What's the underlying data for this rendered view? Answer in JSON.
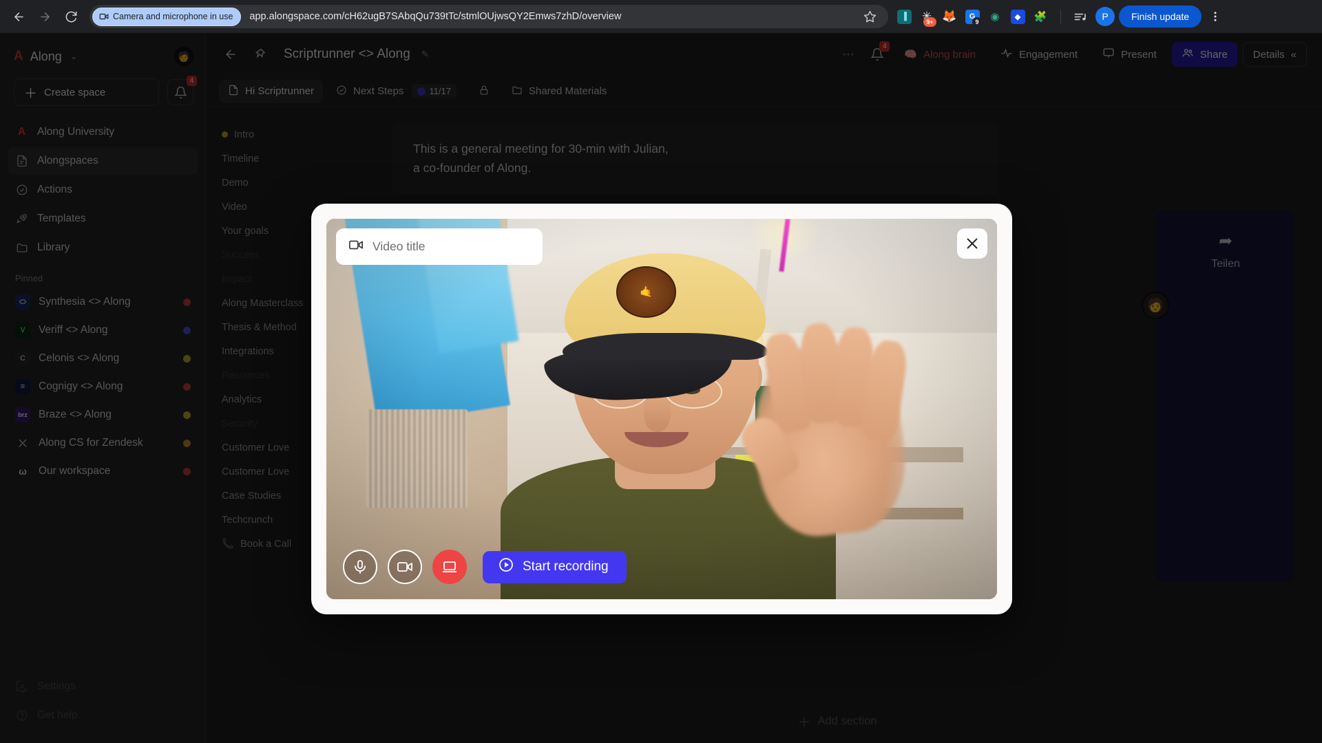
{
  "browser": {
    "back_icon": "arrow-left-icon",
    "forward_icon": "arrow-right-icon",
    "reload_icon": "reload-icon",
    "camera_chip": "Camera and microphone in use",
    "url": "app.alongspace.com/cH62ugB7SAbqQu739tTc/stmlOUjwsQY2Emws7zhD/overview",
    "star_icon": "bookmark-star-icon",
    "extensions": [
      {
        "name": "height-extension-icon",
        "glyph": "▐",
        "bg": "#0f6e73",
        "fg": "#7fe3e8",
        "badge": ""
      },
      {
        "name": "notifications-extension-icon",
        "glyph": "✻",
        "bg": "#f25c3c",
        "fg": "#ffffff",
        "badge": "9+"
      },
      {
        "name": "metamask-extension-icon",
        "glyph": "🦊",
        "bg": "transparent",
        "fg": "#e8883a",
        "badge": ""
      },
      {
        "name": "grammarly-extension-icon",
        "glyph": "G",
        "bg": "#1a73e8",
        "fg": "#ffffff",
        "badge": "9"
      },
      {
        "name": "eye-extension-icon",
        "glyph": "◉",
        "bg": "transparent",
        "fg": "#2ea88a",
        "badge": ""
      },
      {
        "name": "blue-extension-icon",
        "glyph": "◆",
        "bg": "#1b4ae0",
        "fg": "#ffffff",
        "badge": ""
      },
      {
        "name": "puzzle-extensions-icon",
        "glyph": "🧩",
        "bg": "transparent",
        "fg": "#bdc1c6",
        "badge": ""
      }
    ],
    "reading_list_icon": "reading-list-icon",
    "profile_initial": "P",
    "finish_update_label": "Finish update",
    "menu_icon": "kebab-menu-icon"
  },
  "sidebar": {
    "workspace": {
      "name": "Along",
      "caret": "⌄",
      "avatar_initial": ""
    },
    "create_space_label": "Create space",
    "notifications_badge": "4",
    "nav": [
      {
        "label": "Along University",
        "icon": "along-logo-icon",
        "active": false
      },
      {
        "label": "Alongspaces",
        "icon": "document-icon",
        "active": true
      },
      {
        "label": "Actions",
        "icon": "check-circle-icon",
        "active": false
      },
      {
        "label": "Templates",
        "icon": "rocket-icon",
        "active": false
      },
      {
        "label": "Library",
        "icon": "folder-icon",
        "active": false
      }
    ],
    "pinned_label": "Pinned",
    "pinned": [
      {
        "label": "Synthesia <> Along",
        "logo": "⬭",
        "logo_bg": "#1b2a63",
        "dot": "#c04040"
      },
      {
        "label": "Veriff <> Along",
        "logo": "V",
        "logo_bg": "#0c2a16",
        "dot": "#4b4fd0"
      },
      {
        "label": "Celonis <> Along",
        "logo": "C",
        "logo_bg": "#2a2a2a",
        "dot": "#b8ad33"
      },
      {
        "label": "Cognigy <> Along",
        "logo": "≡",
        "logo_bg": "#131a45",
        "dot": "#c04040"
      },
      {
        "label": "Braze <> Along",
        "logo": "b",
        "logo_bg": "#3a1a6e",
        "dot": "#b8ad33"
      },
      {
        "label": "Along CS for Zendesk",
        "logo": "✕",
        "logo_bg": "#2a2a2a",
        "dot": "#c08a33"
      },
      {
        "label": "Our workspace",
        "logo": "ω",
        "logo_bg": "#2a2a2a",
        "dot": "#c04040"
      }
    ],
    "bottom": [
      {
        "label": "Settings",
        "icon": "gear-icon"
      },
      {
        "label": "Get help",
        "icon": "question-circle-icon"
      }
    ]
  },
  "topbar": {
    "back_icon": "back-arrow-icon",
    "pin_icon": "pin-icon",
    "title": "Scriptrunner <> Along",
    "edit_icon": "pencil-icon",
    "more_icon": "more-icon",
    "bell_icon": "bell-icon",
    "bell_badge": "4",
    "buttons": [
      {
        "label": "Along brain",
        "icon": "brain-icon",
        "style": "brain"
      },
      {
        "label": "Engagement",
        "icon": "pulse-icon",
        "style": "plain"
      },
      {
        "label": "Present",
        "icon": "present-icon",
        "style": "plain"
      },
      {
        "label": "Share",
        "icon": "people-icon",
        "style": "share"
      },
      {
        "label": "Details",
        "icon": "chevrons-left-icon",
        "style": "details"
      }
    ]
  },
  "tabs": [
    {
      "label": "Hi Scriptrunner",
      "icon": "page-icon",
      "active": true,
      "badge": ""
    },
    {
      "label": "Next Steps",
      "icon": "check-circle-icon",
      "active": false,
      "badge": "11/17"
    },
    {
      "label": "",
      "icon": "lock-icon",
      "active": false,
      "badge": ""
    },
    {
      "label": "Shared Materials",
      "icon": "folder-icon",
      "active": false,
      "badge": ""
    }
  ],
  "toc": [
    {
      "label": "Intro",
      "dot": true,
      "faint": false
    },
    {
      "label": "Timeline",
      "dot": false,
      "faint": false
    },
    {
      "label": "Demo",
      "dot": false,
      "faint": false
    },
    {
      "label": "Video",
      "dot": false,
      "faint": false
    },
    {
      "label": "Your goals",
      "dot": false,
      "faint": false
    },
    {
      "label": "Success",
      "dot": false,
      "faint": true
    },
    {
      "label": "Impact",
      "dot": false,
      "faint": true
    },
    {
      "label": "Along Masterclass",
      "dot": false,
      "faint": false
    },
    {
      "label": "Thesis & Method",
      "dot": false,
      "faint": false
    },
    {
      "label": "Integrations",
      "dot": false,
      "faint": false
    },
    {
      "label": "Resources",
      "dot": false,
      "faint": true
    },
    {
      "label": "Analytics",
      "dot": false,
      "faint": false
    },
    {
      "label": "Security",
      "dot": false,
      "faint": true
    },
    {
      "label": "Customer Love",
      "dot": false,
      "faint": false
    },
    {
      "label": "Customer Love",
      "dot": false,
      "faint": false
    },
    {
      "label": "Case Studies",
      "dot": false,
      "faint": false
    },
    {
      "label": "Techcrunch",
      "dot": false,
      "faint": false
    },
    {
      "label": "Book a Call",
      "dot": false,
      "faint": false,
      "icon": "phone-icon"
    }
  ],
  "doc": {
    "paragraph_line1": "This is a general meeting for 30-min with Julian,",
    "paragraph_line2": "a co-founder of Along.",
    "share_card": {
      "icon": "share-arrow-icon",
      "label": "Teilen",
      "avatar": "👤"
    },
    "add_section_label": "Add section"
  },
  "modal": {
    "title_placeholder": "Video title",
    "title_value": "",
    "video_icon": "video-camera-icon",
    "close_icon": "close-x-icon",
    "controls": [
      {
        "name": "microphone-toggle",
        "icon": "microphone-icon",
        "state": "on"
      },
      {
        "name": "camera-toggle",
        "icon": "video-camera-icon",
        "state": "on"
      },
      {
        "name": "screen-share-toggle",
        "icon": "screen-icon",
        "state": "active"
      }
    ],
    "start_recording_label": "Start recording",
    "start_recording_icon": "play-circle-icon",
    "accent_color": "#4338f0",
    "record_color": "#ef4444"
  }
}
